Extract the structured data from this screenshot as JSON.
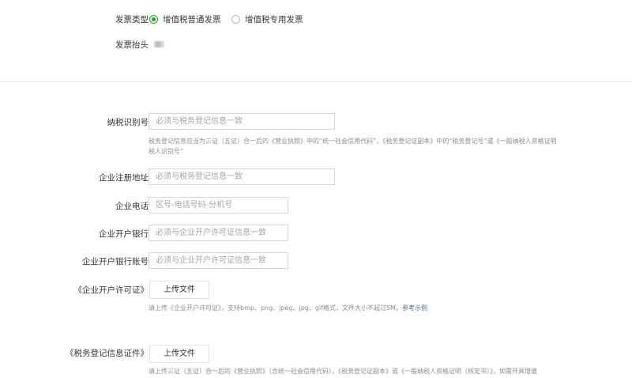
{
  "invoice_type": {
    "label": "发票类型",
    "options": [
      {
        "label": "增值税普通发票",
        "selected": true
      },
      {
        "label": "增值税专用发票",
        "selected": false
      }
    ]
  },
  "invoice_title": {
    "label": "发票抬头"
  },
  "fields": {
    "tax_id": {
      "label": "纳税识别号",
      "placeholder": "必须与税务登记信息一致"
    },
    "tax_hint_line1": "税务登记信息应当为三证（五证）合一后的《营业执照》中的“统一社会信用代码”，《税务登记证副本》中的“税务登记号”或《一般纳税人资格证明",
    "tax_hint_line2": "税人识别号”",
    "address": {
      "label": "企业注册地址",
      "placeholder": "必须与税务登记信息一致"
    },
    "phone": {
      "label": "企业电话",
      "placeholder": "区号-电话号码-分机号"
    },
    "bank": {
      "label": "企业开户银行",
      "placeholder": "必须与企业开户许可证信息一致"
    },
    "account": {
      "label": "企业开户银行账号",
      "placeholder": "必须与企业开户许可证信息一致"
    }
  },
  "license_upload": {
    "label": "《企业开户许可证》",
    "button": "上传文件",
    "hint": "请上传《企业开户许可证》，支持bmp、png、jpeg、jpg、gif格式，文件大小不超过5M。",
    "link": "参考示例"
  },
  "tax_cert_upload": {
    "label": "《税务登记信息证件》",
    "button": "上传文件",
    "hint": "请上传三证（五证）合一后的《营业执照》（含统一社会信用代码），《税务登记证副本》或《一般纳税人资格证明（核定书）》，如需开具增值"
  },
  "colors": {
    "accent": "#1aad19",
    "link": "#576b95",
    "border": "#d9d9d9",
    "placeholder": "#a6a6a6"
  }
}
